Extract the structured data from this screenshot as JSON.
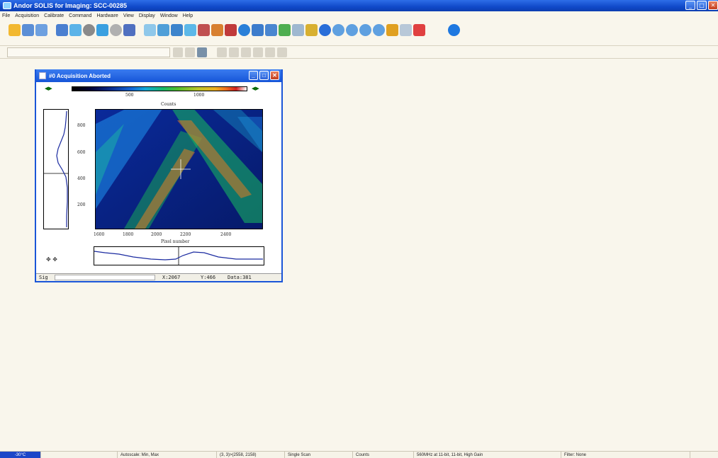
{
  "app": {
    "title": "Andor SOLIS for Imaging: SCC-00285"
  },
  "menu": [
    "File",
    "Acquisition",
    "Calibrate",
    "Command",
    "Hardware",
    "View",
    "Display",
    "Window",
    "Help"
  ],
  "window_buttons": {
    "min": "_",
    "max": "□",
    "close": "✕"
  },
  "child_window": {
    "title": "#0  Acquisition Aborted",
    "colorbar_ticks": [
      "500",
      "1000"
    ],
    "heatmap_title": "Counts",
    "y_ticks": [
      "800",
      "600",
      "400",
      "200"
    ],
    "x_ticks": [
      "1600",
      "1800",
      "2000",
      "2200",
      "2400"
    ],
    "x_label": "Pixel number",
    "status": {
      "tab": "Sig",
      "x": "X:2067",
      "y": "Y:466",
      "data": "Data:381"
    }
  },
  "statusbar": {
    "temperature": "-30°C",
    "autoscale": "Autoscale: Min, Max",
    "region": "(3, 3)>(2558, 2158)",
    "mode": "Single Scan",
    "units": "Counts",
    "readout": "560MHz at 11-bit, 11-bit, High Gain",
    "filter": "Filter: None"
  },
  "icons": [
    "open-folder-icon",
    "print-icon",
    "save-icon",
    "run-icon",
    "abort-icon",
    "help-icon"
  ]
}
